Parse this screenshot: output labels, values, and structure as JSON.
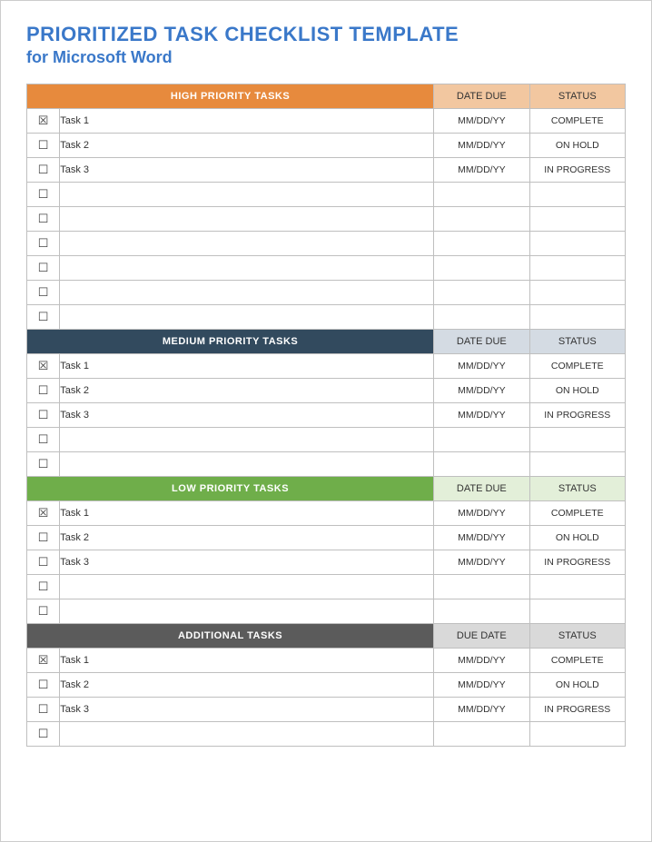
{
  "title": {
    "line1": "PRIORITIZED TASK CHECKLIST TEMPLATE",
    "line2": "for Microsoft Word"
  },
  "sections": [
    {
      "header": "HIGH PRIORITY TASKS",
      "due_header": "DATE DUE",
      "status_header": "STATUS",
      "header_bg": "#e78a3d",
      "col_bg": "#f2c7a0",
      "rows": [
        {
          "checked": true,
          "task": "Task 1",
          "due": "MM/DD/YY",
          "status": "COMPLETE"
        },
        {
          "checked": false,
          "task": "Task 2",
          "due": "MM/DD/YY",
          "status": "ON HOLD"
        },
        {
          "checked": false,
          "task": "Task 3",
          "due": "MM/DD/YY",
          "status": "IN PROGRESS"
        },
        {
          "checked": false,
          "task": "",
          "due": "",
          "status": ""
        },
        {
          "checked": false,
          "task": "",
          "due": "",
          "status": ""
        },
        {
          "checked": false,
          "task": "",
          "due": "",
          "status": ""
        },
        {
          "checked": false,
          "task": "",
          "due": "",
          "status": ""
        },
        {
          "checked": false,
          "task": "",
          "due": "",
          "status": ""
        },
        {
          "checked": false,
          "task": "",
          "due": "",
          "status": ""
        }
      ]
    },
    {
      "header": "MEDIUM PRIORITY TASKS",
      "due_header": "DATE DUE",
      "status_header": "STATUS",
      "header_bg": "#324a5e",
      "col_bg": "#d4dbe3",
      "rows": [
        {
          "checked": true,
          "task": "Task 1",
          "due": "MM/DD/YY",
          "status": "COMPLETE"
        },
        {
          "checked": false,
          "task": "Task 2",
          "due": "MM/DD/YY",
          "status": "ON HOLD"
        },
        {
          "checked": false,
          "task": "Task 3",
          "due": "MM/DD/YY",
          "status": "IN PROGRESS"
        },
        {
          "checked": false,
          "task": "",
          "due": "",
          "status": ""
        },
        {
          "checked": false,
          "task": "",
          "due": "",
          "status": ""
        }
      ]
    },
    {
      "header": "LOW PRIORITY TASKS",
      "due_header": "DATE DUE",
      "status_header": "STATUS",
      "header_bg": "#6fae4a",
      "col_bg": "#e3efd9",
      "rows": [
        {
          "checked": true,
          "task": "Task 1",
          "due": "MM/DD/YY",
          "status": "COMPLETE"
        },
        {
          "checked": false,
          "task": "Task 2",
          "due": "MM/DD/YY",
          "status": "ON HOLD"
        },
        {
          "checked": false,
          "task": "Task 3",
          "due": "MM/DD/YY",
          "status": "IN PROGRESS"
        },
        {
          "checked": false,
          "task": "",
          "due": "",
          "status": ""
        },
        {
          "checked": false,
          "task": "",
          "due": "",
          "status": ""
        }
      ]
    },
    {
      "header": "ADDITIONAL TASKS",
      "due_header": "DUE DATE",
      "status_header": "STATUS",
      "header_bg": "#5b5b5b",
      "col_bg": "#d9d9d9",
      "rows": [
        {
          "checked": true,
          "task": "Task 1",
          "due": "MM/DD/YY",
          "status": "COMPLETE"
        },
        {
          "checked": false,
          "task": "Task 2",
          "due": "MM/DD/YY",
          "status": "ON HOLD"
        },
        {
          "checked": false,
          "task": "Task 3",
          "due": "MM/DD/YY",
          "status": "IN PROGRESS"
        },
        {
          "checked": false,
          "task": "",
          "due": "",
          "status": ""
        }
      ]
    }
  ]
}
